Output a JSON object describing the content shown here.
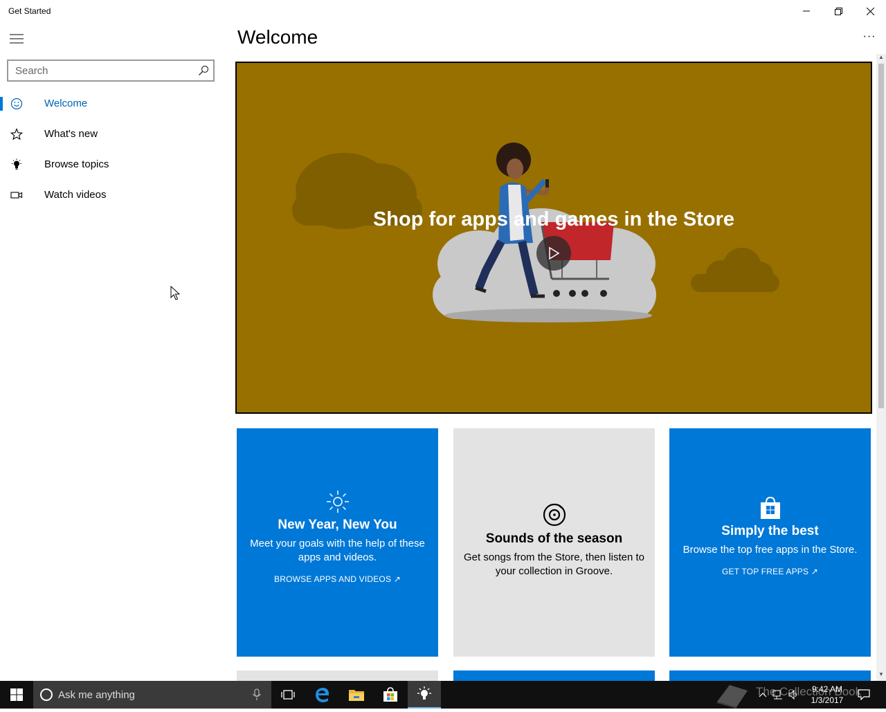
{
  "window": {
    "title": "Get Started"
  },
  "sidebar": {
    "search_placeholder": "Search",
    "items": [
      {
        "label": "Welcome",
        "icon": "smiley-icon",
        "active": true
      },
      {
        "label": "What's new",
        "icon": "star-icon",
        "active": false
      },
      {
        "label": "Browse topics",
        "icon": "lightbulb-icon",
        "active": false
      },
      {
        "label": "Watch videos",
        "icon": "video-camera-icon",
        "active": false
      }
    ]
  },
  "main": {
    "title": "Welcome",
    "more_label": "···",
    "hero": {
      "title": "Shop for apps and games in the Store",
      "background": "#977000"
    },
    "tiles": [
      {
        "icon": "sun-icon",
        "title": "New Year, New You",
        "description": "Meet your goals with the help of these apps and videos.",
        "link": "BROWSE APPS AND VIDEOS ↗",
        "color": "#0078d7"
      },
      {
        "icon": "music-disc-icon",
        "title": "Sounds of the season",
        "description": "Get songs from the Store, then listen to your collection in Groove.",
        "link": "",
        "color": "#e3e3e3"
      },
      {
        "icon": "store-bag-icon",
        "title": "Simply the best",
        "description": "Browse the top free apps in the Store.",
        "link": "GET TOP FREE APPS ↗",
        "color": "#0078d7"
      }
    ]
  },
  "taskbar": {
    "search_placeholder": "Ask me anything",
    "time": "9:42 AM",
    "date": "1/3/2017",
    "watermark": "The Collection Book"
  }
}
